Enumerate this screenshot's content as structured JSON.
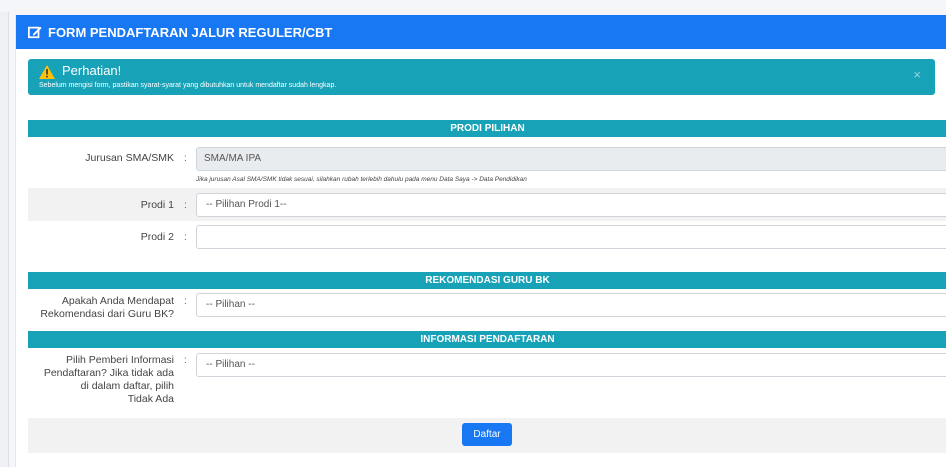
{
  "header": {
    "title": "FORM PENDAFTARAN JALUR REGULER/CBT",
    "icon": "edit-icon"
  },
  "alert": {
    "title": "Perhatian!",
    "message": "Sebelum mengisi form, pastikan syarat-syarat yang dibutuhkan untuk mendaftar sudah lengkap.",
    "close": "×",
    "icon": "warning-icon"
  },
  "sections": {
    "prodi": "PRODI PILIHAN",
    "rekomendasi": "REKOMENDASI GURU BK",
    "informasi": "INFORMASI PENDAFTARAN"
  },
  "form": {
    "jurusan": {
      "label": "Jurusan SMA/SMK",
      "value": "SMA/MA IPA",
      "hint": "Jika jurusan Asal SMA/SMK tidak sesuai, silahkan rubah terlebih dahulu pada menu Data Saya -> Data Pendidikan"
    },
    "prodi1": {
      "label": "Prodi 1",
      "value": "-- Pilihan Prodi 1--"
    },
    "prodi2": {
      "label": "Prodi 2",
      "value": ""
    },
    "rekomendasi": {
      "label_line1": "Apakah Anda Mendapat",
      "label_line2": "Rekomendasi dari Guru BK?",
      "value": "-- Pilihan --"
    },
    "informasi": {
      "label_line1": "Pilih Pemberi Informasi",
      "label_line2": "Pendaftaran? Jika tidak ada",
      "label_line3": "di dalam daftar, pilih",
      "label_line4": "Tidak Ada",
      "value": "-- Pilihan --"
    },
    "colon": ":",
    "chevron": "⌄"
  },
  "submit_label": "Daftar",
  "colors": {
    "primary": "#1877f2",
    "info": "#17a2b8"
  }
}
